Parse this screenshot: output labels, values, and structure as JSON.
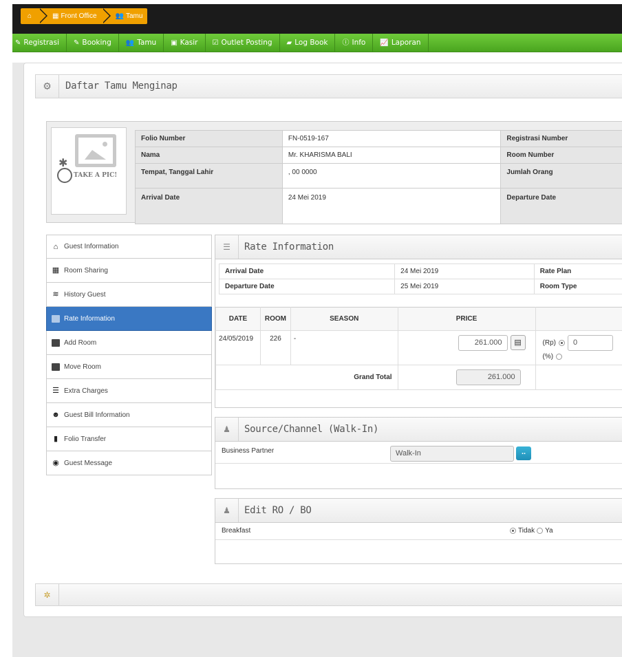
{
  "breadcrumb": {
    "home_icon": "home-icon",
    "items": [
      {
        "label": "Front Office",
        "icon": "calendar-icon"
      },
      {
        "label": "Tamu",
        "icon": "users-icon"
      }
    ]
  },
  "menu": [
    {
      "label": "Registrasi",
      "icon": "edit-icon"
    },
    {
      "label": "Booking",
      "icon": "edit-icon"
    },
    {
      "label": "Tamu",
      "icon": "users-icon"
    },
    {
      "label": "Kasir",
      "icon": "money-icon"
    },
    {
      "label": "Outlet Posting",
      "icon": "check-square-icon"
    },
    {
      "label": "Log Book",
      "icon": "book-icon"
    },
    {
      "label": "Info",
      "icon": "info-icon"
    },
    {
      "label": "Laporan",
      "icon": "chart-icon"
    }
  ],
  "page": {
    "title": "Daftar Tamu Menginap"
  },
  "photo": {
    "caption": "TAKE A PIC!"
  },
  "folio": {
    "folio_number_label": "Folio Number",
    "folio_number_value": "FN-0519-167",
    "registrasi_label": "Registrasi Number",
    "nama_label": "Nama",
    "nama_value": "Mr. KHARISMA BALI",
    "room_number_label": "Room Number",
    "ttl_label": "Tempat, Tanggal Lahir",
    "ttl_value": ", 00 0000",
    "jumlah_label": "Jumlah Orang",
    "arrival_label": "Arrival Date",
    "arrival_value": "24 Mei 2019",
    "departure_label": "Departure Date"
  },
  "sidenav": [
    {
      "label": "Guest Information",
      "icon": "home-icon",
      "active": false
    },
    {
      "label": "Room Sharing",
      "icon": "grid-icon",
      "active": false
    },
    {
      "label": "History Guest",
      "icon": "layers-icon",
      "active": false
    },
    {
      "label": "Rate Information",
      "icon": "chart-icon",
      "active": true
    },
    {
      "label": "Add Room",
      "icon": "chart-icon",
      "active": false
    },
    {
      "label": "Move Room",
      "icon": "chart-icon",
      "active": false
    },
    {
      "label": "Extra Charges",
      "icon": "list-icon",
      "active": false
    },
    {
      "label": "Guest Bill Information",
      "icon": "group-icon",
      "active": false
    },
    {
      "label": "Folio Transfer",
      "icon": "book-icon",
      "active": false
    },
    {
      "label": "Guest Message",
      "icon": "gamepad-icon",
      "active": false
    }
  ],
  "rate": {
    "title": "Rate Information",
    "arrival_label": "Arrival Date",
    "arrival_value": "24 Mei 2019",
    "rate_plan_label": "Rate Plan",
    "departure_label": "Departure Date",
    "departure_value": "25 Mei 2019",
    "room_type_label": "Room Type",
    "columns": [
      "DATE",
      "ROOM",
      "SEASON",
      "PRICE",
      "("
    ],
    "row": {
      "date": "24/05/2019",
      "room": "226",
      "season": "-",
      "price": "261.000",
      "discount": "0"
    },
    "rp_label": "(Rp)",
    "pct_label": "(%)",
    "grand_total_label": "Grand Total",
    "grand_total_value": "261.000"
  },
  "source": {
    "title": "Source/Channel (Walk-In)",
    "partner_label": "Business Partner",
    "partner_value": "Walk-In",
    "button": ".."
  },
  "robo": {
    "title": "Edit RO / BO",
    "breakfast_label": "Breakfast",
    "opt_tidak": "Tidak",
    "opt_ya": "Ya"
  }
}
